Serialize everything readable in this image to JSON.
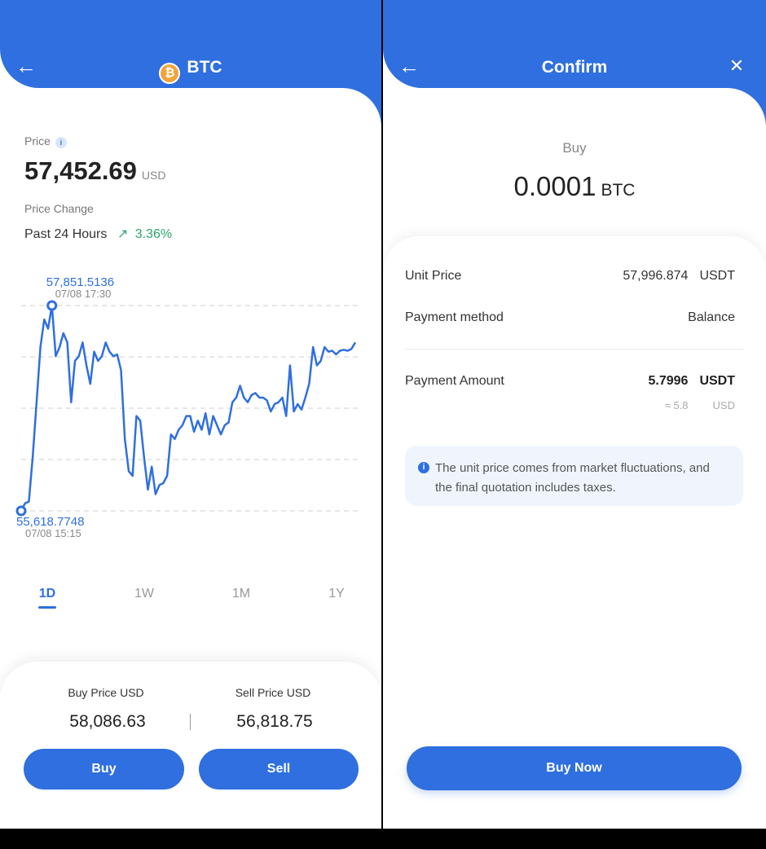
{
  "left_screen": {
    "header": {
      "back_icon": "←",
      "coin_symbol": "₿",
      "title": "BTC"
    },
    "price": {
      "label": "Price",
      "info_icon": "i",
      "value": "57,452.69",
      "currency": "USD"
    },
    "change": {
      "label": "Price Change",
      "period": "Past 24 Hours",
      "arrow": "↗",
      "percent": "3.36%"
    },
    "timeframes": [
      "1D",
      "1W",
      "1M",
      "1Y"
    ],
    "active_timeframe": "1D",
    "trade": {
      "buy_label": "Buy Price USD",
      "buy_value": "58,086.63",
      "sell_label": "Sell Price USD",
      "sell_value": "56,818.75",
      "buy_button": "Buy",
      "sell_button": "Sell"
    }
  },
  "right_screen": {
    "header": {
      "back_icon": "←",
      "title": "Confirm",
      "close_icon": "✕"
    },
    "summary": {
      "label": "Buy",
      "amount": "0.0001",
      "currency": "BTC"
    },
    "details": {
      "unit_price_label": "Unit Price",
      "unit_price_value": "57,996.874",
      "unit_price_currency": "USDT",
      "method_label": "Payment method",
      "method_value": "Balance",
      "amount_label": "Payment Amount",
      "amount_value": "5.7996",
      "amount_currency": "USDT",
      "approx_value": "≈ 5.8",
      "approx_currency": "USD"
    },
    "note": {
      "icon": "i",
      "text": "The unit price comes from market fluctuations, and the final quotation includes taxes."
    },
    "buy_now_button": "Buy Now"
  },
  "colors": {
    "accent": "#2f6fe0",
    "positive": "#2aa46a"
  },
  "chart_data": {
    "type": "line",
    "series": [
      {
        "values": [
          55618.77,
          55700,
          55720,
          56200,
          56800,
          57400,
          57700,
          57600,
          57851.51,
          57300,
          57400,
          57550,
          57450,
          56800,
          57250,
          57300,
          57450,
          57200,
          57000,
          57350,
          57250,
          57300,
          57450,
          57350,
          57300,
          57320,
          57150,
          56400,
          56050,
          56000,
          56650,
          56600,
          56200,
          55850,
          56100,
          55800,
          55900,
          55920,
          56000,
          56450,
          56400,
          56500,
          56550,
          56650,
          56650,
          56480,
          56600,
          56500,
          56680,
          56450,
          56650,
          56550,
          56450,
          56550,
          56580,
          56800,
          56850,
          56980,
          56850,
          56800,
          56880,
          56900,
          56850,
          56850,
          56820,
          56700,
          56780,
          56800,
          56850,
          56650,
          57200,
          56700,
          56780,
          56720,
          56850,
          57000,
          57400,
          57200,
          57250,
          57400,
          57350,
          57360,
          57320,
          57360,
          57370,
          57360,
          57380,
          57450
        ]
      }
    ],
    "annotations": [
      {
        "label": "57,851.5136",
        "time": "07/08 17:30",
        "kind": "high"
      },
      {
        "label": "55,618.7748",
        "time": "07/08 15:15",
        "kind": "low"
      }
    ],
    "grid": true
  }
}
